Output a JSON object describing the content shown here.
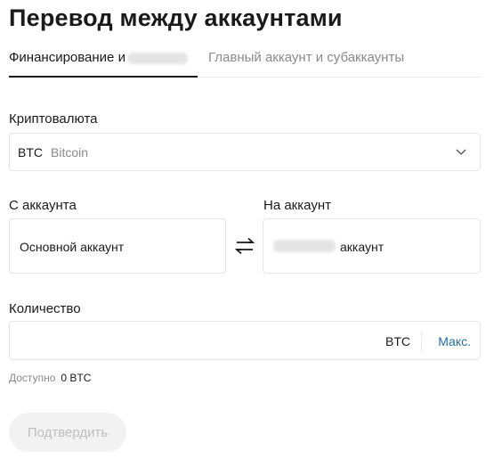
{
  "page": {
    "title": "Перевод между аккаунтами"
  },
  "tabs": [
    {
      "label": "Финансирование и",
      "active": true
    },
    {
      "label": "Главный аккаунт и субаккаунты",
      "active": false
    }
  ],
  "crypto": {
    "label": "Криптовалюта",
    "ticker": "BTC",
    "name": "Bitcoin",
    "icon": "chevron-down-icon"
  },
  "from_account": {
    "label": "С аккаунта",
    "value": "Основной аккаунт"
  },
  "to_account": {
    "label": "На аккаунт",
    "value": "аккаунт"
  },
  "swap": {
    "icon": "swap-icon"
  },
  "quantity": {
    "label": "Количество",
    "value": "",
    "placeholder": "",
    "unit": "BTC",
    "max_label": "Макс."
  },
  "available": {
    "label": "Доступно",
    "amount": "0 BTC"
  },
  "confirm": {
    "label": "Подтвердить"
  },
  "colors": {
    "accent": "#1f6fa8",
    "text": "#1a1a1a",
    "muted": "#8a8a8a",
    "border": "#e6e6e6",
    "disabled_bg": "#f2f2f2"
  }
}
